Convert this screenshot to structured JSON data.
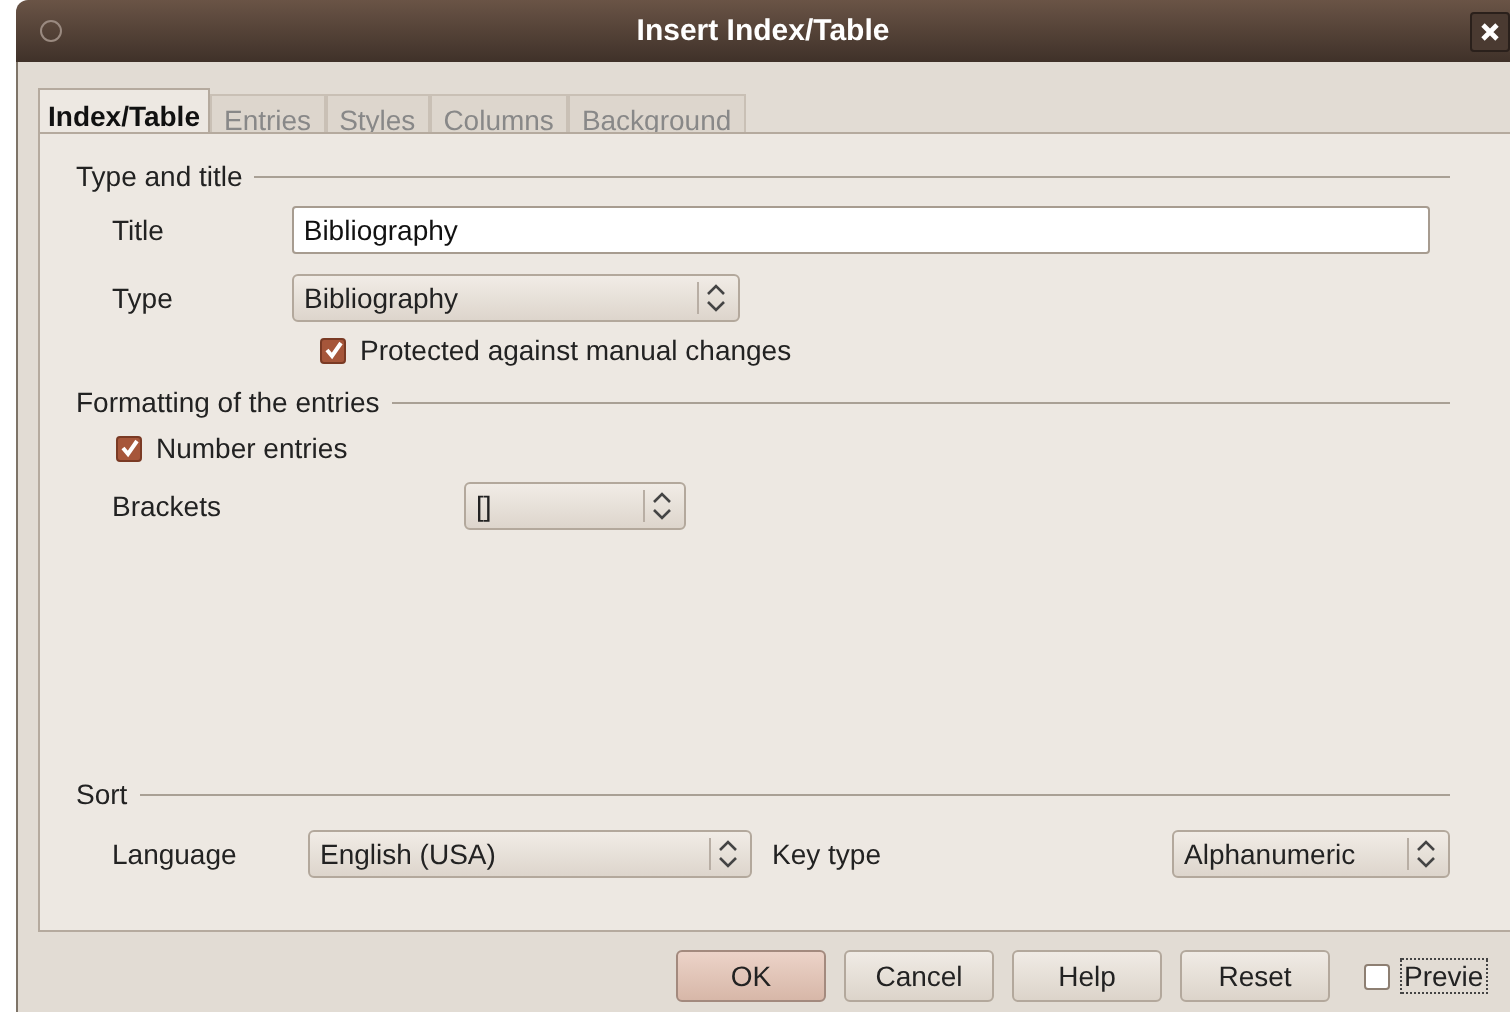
{
  "window": {
    "title": "Insert Index/Table"
  },
  "tabs": [
    {
      "label": "Index/Table",
      "selected": true
    },
    {
      "label": "Entries",
      "selected": false
    },
    {
      "label": "Styles",
      "selected": false
    },
    {
      "label": "Columns",
      "selected": false
    },
    {
      "label": "Background",
      "selected": false
    }
  ],
  "type_and_title": {
    "heading": "Type and title",
    "title_label": "Title",
    "title_value": "Bibliography",
    "type_label": "Type",
    "type_value": "Bibliography",
    "protected": {
      "label": "Protected against manual changes",
      "checked": true
    }
  },
  "formatting": {
    "heading": "Formatting of the entries",
    "number_entries": {
      "label": "Number entries",
      "checked": true
    },
    "brackets_label": "Brackets",
    "brackets_value": "[]"
  },
  "sort": {
    "heading": "Sort",
    "language_label": "Language",
    "language_value": "English (USA)",
    "key_type_label": "Key type",
    "key_type_value": "Alphanumeric"
  },
  "buttons": [
    {
      "label": "OK",
      "default": true
    },
    {
      "label": "Cancel",
      "default": false
    },
    {
      "label": "Help",
      "default": false
    },
    {
      "label": "Reset",
      "default": false
    }
  ],
  "preview": {
    "label": "Previe",
    "checked": false
  }
}
